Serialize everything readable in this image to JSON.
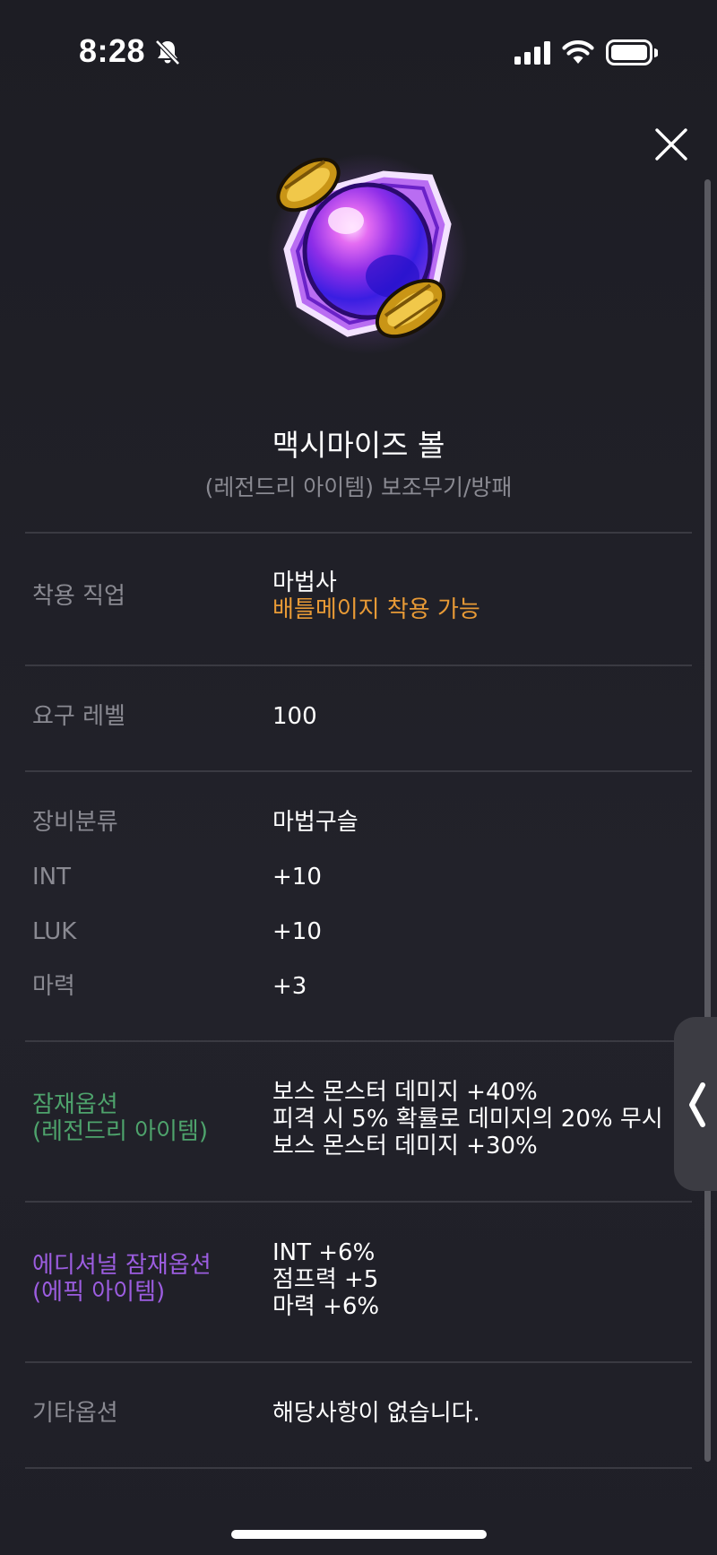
{
  "status_bar": {
    "time": "8:28",
    "icons": [
      "bell-slash-icon",
      "cellular-signal-icon",
      "wifi-icon",
      "battery-icon"
    ]
  },
  "item": {
    "image_icon": "orb-icon",
    "name": "맥시마이즈 볼",
    "subtitle": "(레전드리 아이템) 보조무기/방패"
  },
  "job": {
    "label": "착용 직업",
    "value": "마법사",
    "note": "배틀메이지 착용 가능"
  },
  "level": {
    "label": "요구 레벨",
    "value": "100"
  },
  "stats": [
    {
      "label": "장비분류",
      "value": "마법구슬"
    },
    {
      "label": "INT",
      "value": "+10"
    },
    {
      "label": "LUK",
      "value": "+10"
    },
    {
      "label": "마력",
      "value": "+3"
    }
  ],
  "potential": {
    "label_line1": "잠재옵션",
    "label_line2": "(레전드리 아이템)",
    "lines": [
      "보스 몬스터 데미지 +40%",
      "피격 시 5% 확률로 데미지의 20% 무시",
      "보스 몬스터 데미지 +30%"
    ]
  },
  "additional_potential": {
    "label_line1": "에디셔널 잠재옵션",
    "label_line2": "(에픽 아이템)",
    "lines": [
      "INT +6%",
      "점프력 +5",
      "마력 +6%"
    ]
  },
  "other": {
    "label": "기타옵션",
    "value": "해당사항이 없습니다."
  },
  "colors": {
    "background": "#1f1f27",
    "label": "#8a8a92",
    "value": "#ffffff",
    "orange": "#e89a36",
    "legendary_green": "#4ea36c",
    "epic_purple": "#9c5de0",
    "divider": "#3a3a42"
  }
}
